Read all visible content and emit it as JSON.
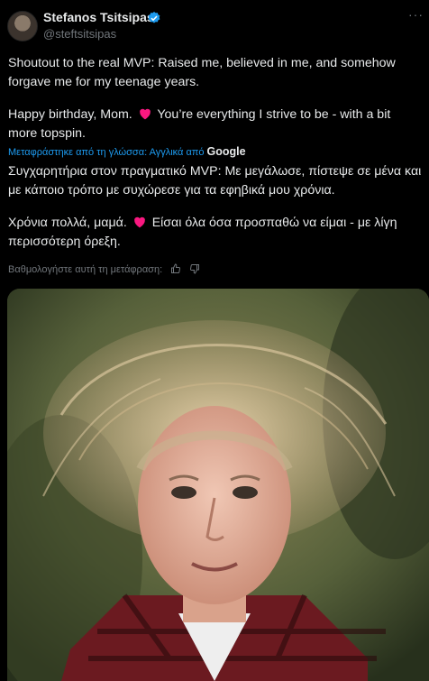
{
  "author": {
    "name": "Stefanos Tsitsipas",
    "handle": "@steftsitsipas",
    "verified": true,
    "icons": {
      "avatar": "profile-photo",
      "verified": "verified-badge-icon",
      "more": "more-icon"
    },
    "more_label": "···"
  },
  "tweet": {
    "line1": "Shoutout to the real MVP: Raised me, believed in me, and somehow forgave me for my teenage years.",
    "line2_before_heart": "Happy birthday, Mom.",
    "line2_after_heart": "You’re everything I strive to be - with a bit more topspin."
  },
  "translation": {
    "label": "Μεταφράστηκε από τη γλώσσα: Αγγλικά από",
    "provider": "Google",
    "line1": "Συγχαρητήρια στον πραγματικό MVP: Με μεγάλωσε, πίστεψε σε μένα και με κάποιο τρόπο με συχώρεσε για τα εφηβικά μου χρόνια.",
    "line2_before_heart": "Χρόνια πολλά, μαμά.",
    "line2_after_heart": "Είσαι όλα όσα προσπαθώ να είμαι - με λίγη περισσότερη όρεξη."
  },
  "rate": {
    "label": "Βαθμολογήστε αυτή τη μετάφραση:",
    "icons": [
      "thumbs-up-icon",
      "thumbs-down-icon"
    ]
  },
  "colors": {
    "link": "#1d9bf0",
    "heart": "#f91880",
    "muted": "#71767b"
  }
}
